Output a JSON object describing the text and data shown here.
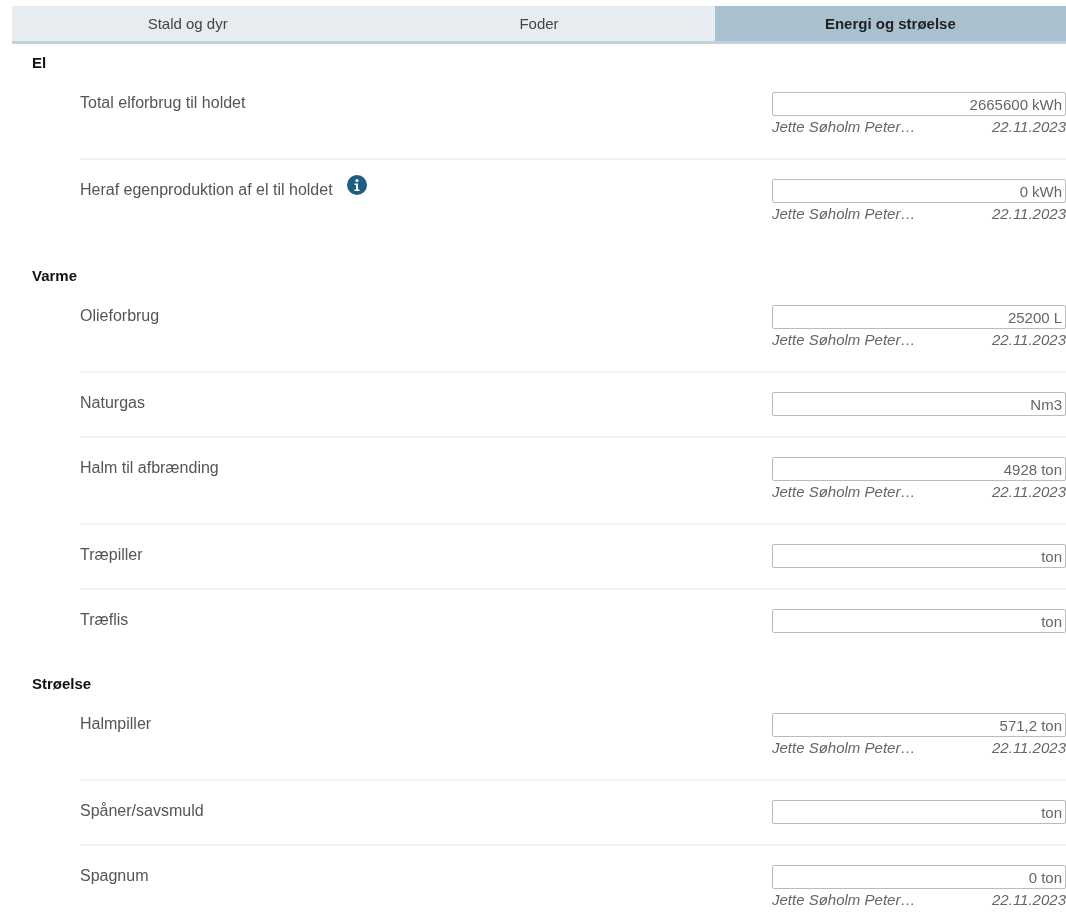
{
  "tabs": [
    {
      "label": "Stald og dyr",
      "selected": false
    },
    {
      "label": "Foder",
      "selected": false
    },
    {
      "label": "Energi og strøelse",
      "selected": true
    }
  ],
  "sections": [
    {
      "title": "El",
      "rows": [
        {
          "label": "Total elforbrug til holdet",
          "info": false,
          "value": "2665600",
          "unit": "kWh",
          "author": "Jette Søholm Peter…",
          "date": "22.11.2023"
        },
        {
          "label": "Heraf egenproduktion af el til holdet",
          "info": true,
          "value": "0",
          "unit": "kWh",
          "author": "Jette Søholm Peter…",
          "date": "22.11.2023"
        }
      ]
    },
    {
      "title": "Varme",
      "rows": [
        {
          "label": "Olieforbrug",
          "info": false,
          "value": "25200",
          "unit": "L",
          "author": "Jette Søholm Peter…",
          "date": "22.11.2023"
        },
        {
          "label": "Naturgas",
          "info": false,
          "unit": "Nm3"
        },
        {
          "label": "Halm til afbrænding",
          "info": false,
          "value": "4928",
          "unit": "ton",
          "author": "Jette Søholm Peter…",
          "date": "22.11.2023"
        },
        {
          "label": "Træpiller",
          "info": false,
          "unit": "ton"
        },
        {
          "label": "Træflis",
          "info": false,
          "unit": "ton"
        }
      ]
    },
    {
      "title": "Strøelse",
      "rows": [
        {
          "label": "Halmpiller",
          "info": false,
          "value": "571,2",
          "unit": "ton",
          "author": "Jette Søholm Peter…",
          "date": "22.11.2023"
        },
        {
          "label": "Spåner/savsmuld",
          "info": false,
          "unit": "ton"
        },
        {
          "label": "Spagnum",
          "info": false,
          "value": "0",
          "unit": "ton",
          "author": "Jette Søholm Peter…",
          "date": "22.11.2023"
        }
      ]
    }
  ]
}
